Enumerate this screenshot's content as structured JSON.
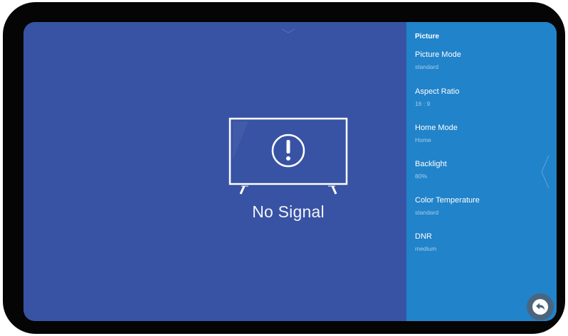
{
  "screen": {
    "message": "No Signal",
    "background_color": "#3853a4",
    "icon": "tv-warning-icon"
  },
  "panel": {
    "title": "Picture",
    "background_color": "#2183c9",
    "items": [
      {
        "label": "Picture Mode",
        "value": "standard"
      },
      {
        "label": "Aspect Ratio",
        "value": "16 : 9"
      },
      {
        "label": "Home Mode",
        "value": "Home"
      },
      {
        "label": "Backlight",
        "value": "80%"
      },
      {
        "label": "Color Temperature",
        "value": "standard"
      },
      {
        "label": "DNR",
        "value": "medium"
      }
    ],
    "back_icon": "back-arrow-icon"
  }
}
